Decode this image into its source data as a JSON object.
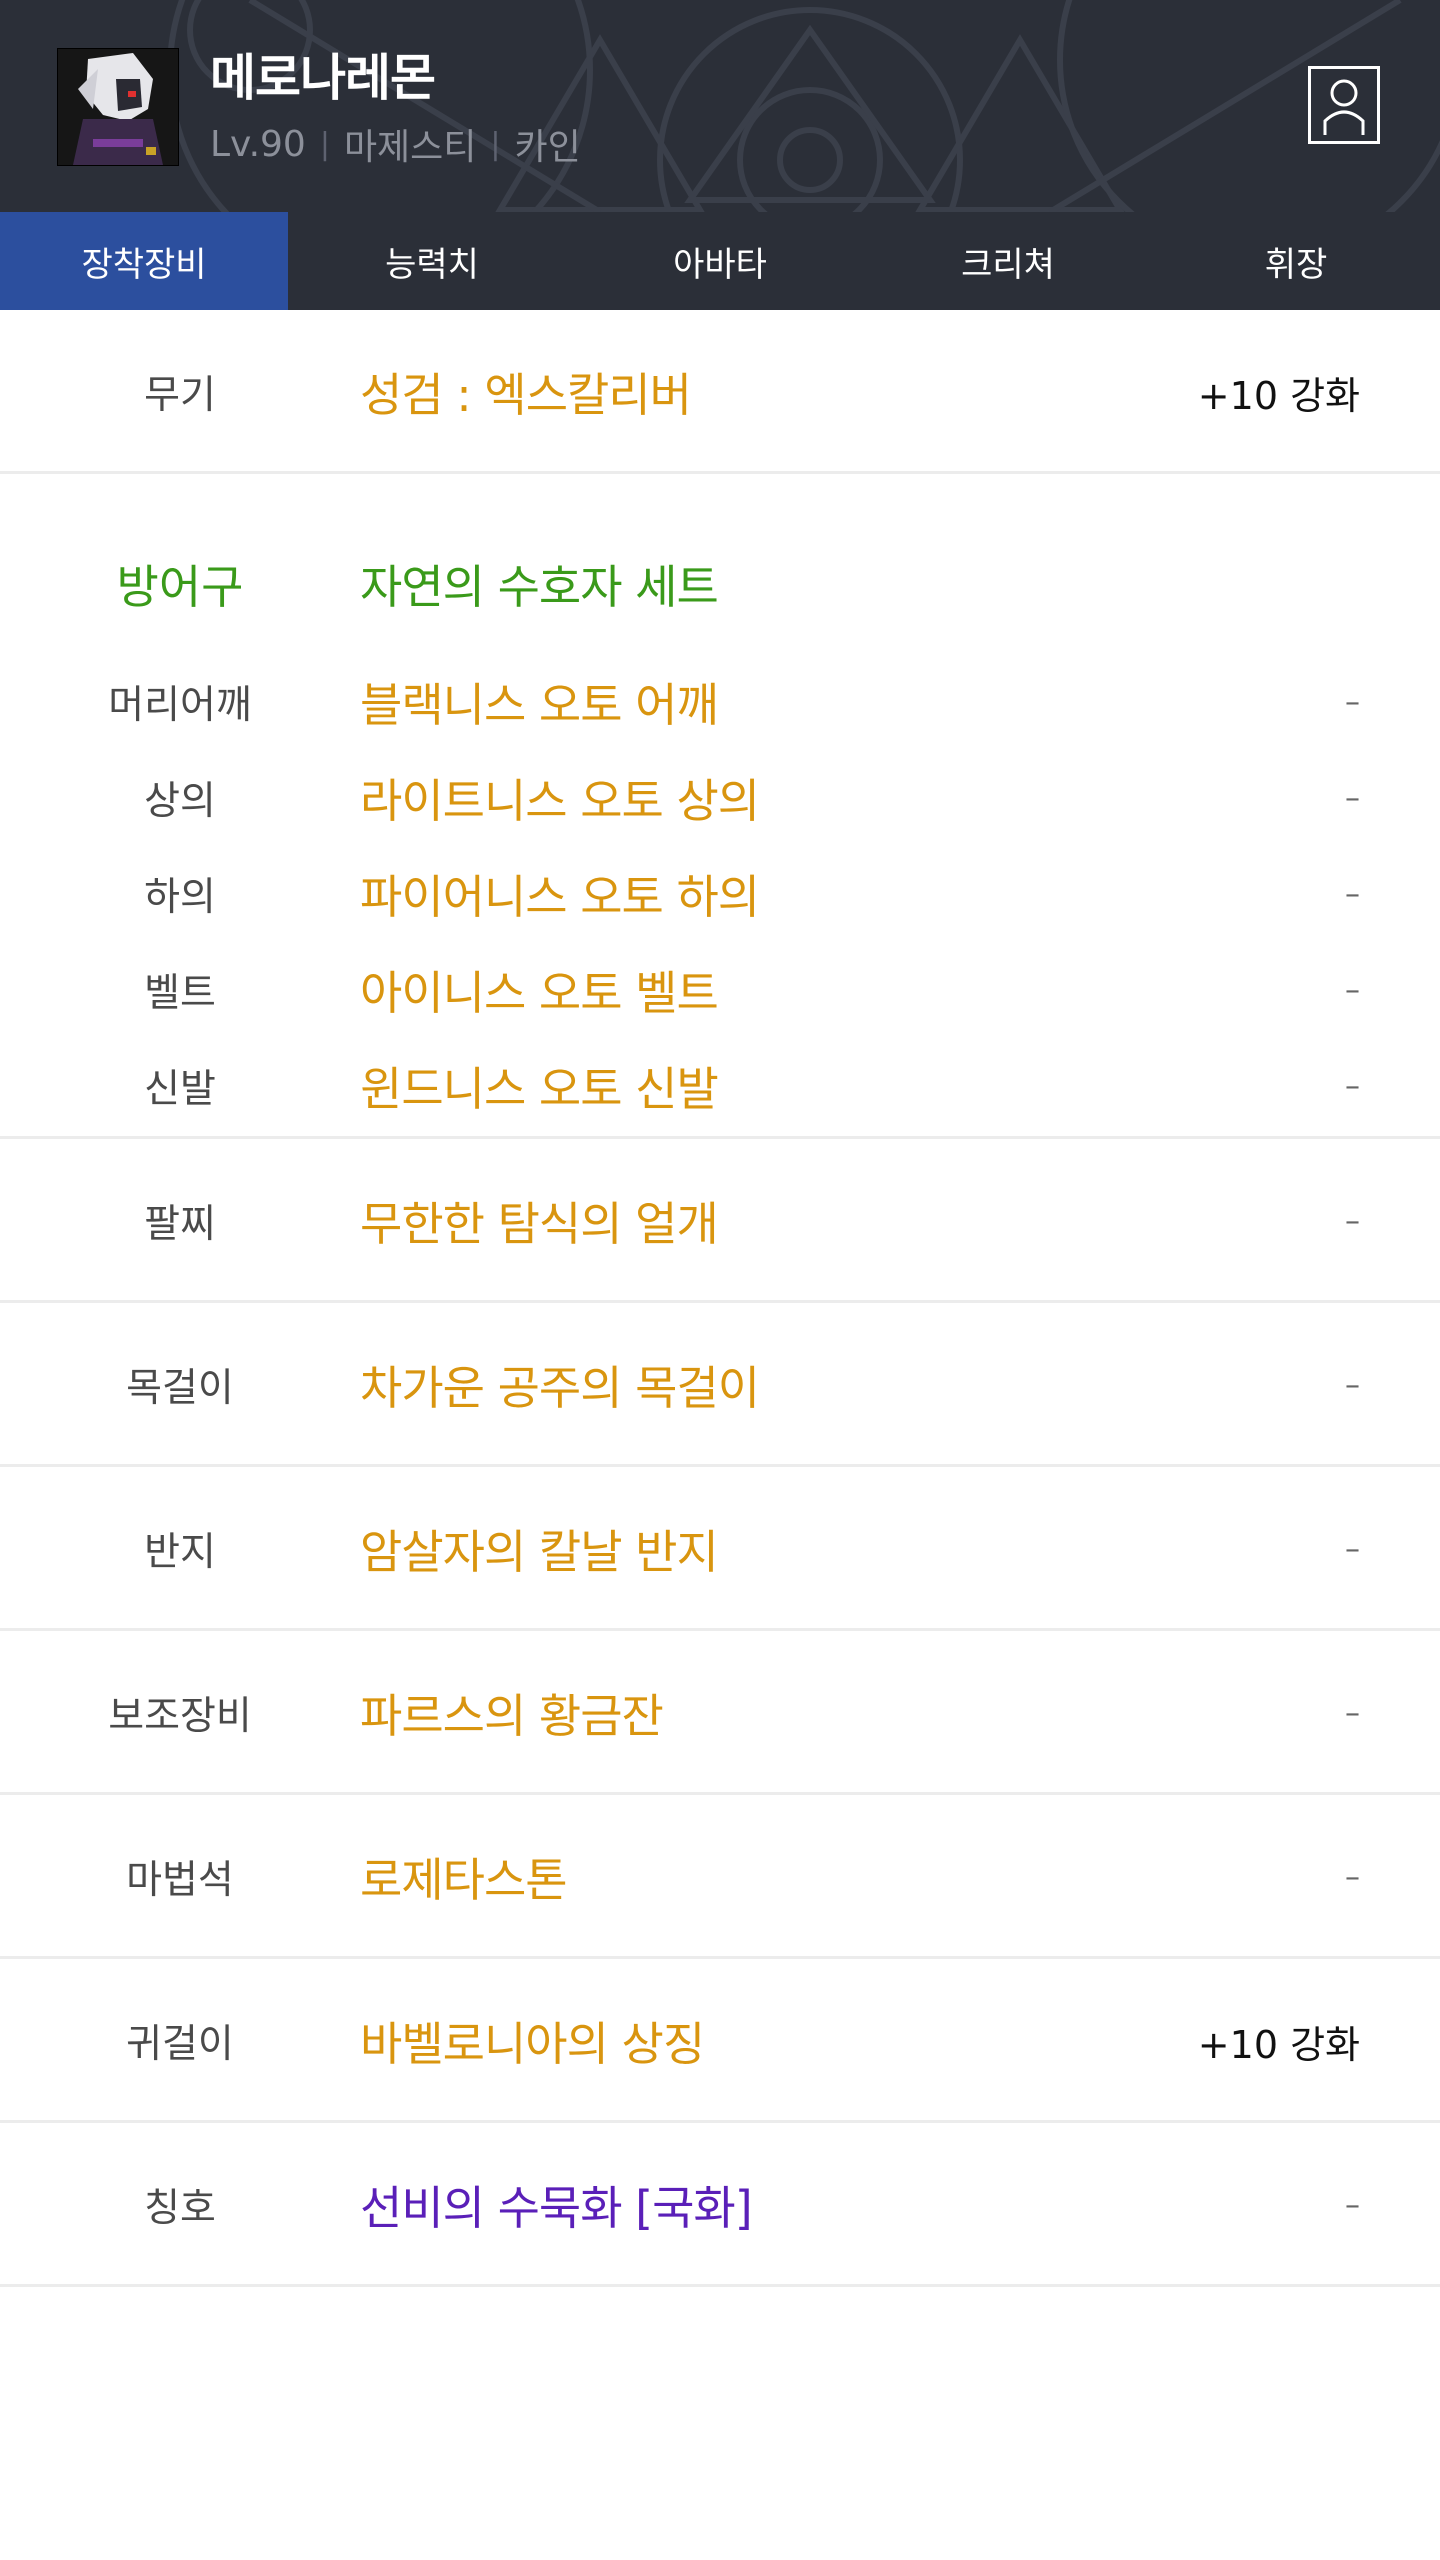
{
  "character": {
    "name": "메로나레몬",
    "level": "Lv.90",
    "class": "마제스티",
    "server": "카인",
    "separator": "|",
    "avatar_icon": "character-avatar-icon",
    "profile_icon": "profile-icon"
  },
  "tabs": [
    {
      "label": "장착장비",
      "active": true
    },
    {
      "label": "능력치",
      "active": false
    },
    {
      "label": "아바타",
      "active": false
    },
    {
      "label": "크리쳐",
      "active": false
    },
    {
      "label": "휘장",
      "active": false
    }
  ],
  "equipment": {
    "weapon": {
      "label": "무기",
      "item": "성검 : 엑스칼리버",
      "value": "+10 강화"
    },
    "armor": {
      "label": "방어구",
      "set_name": "자연의 수호자 세트",
      "pieces": [
        {
          "label": "머리어깨",
          "item": "블랙니스 오토 어깨",
          "value": "–"
        },
        {
          "label": "상의",
          "item": "라이트니스 오토 상의",
          "value": "–"
        },
        {
          "label": "하의",
          "item": "파이어니스 오토 하의",
          "value": "–"
        },
        {
          "label": "벨트",
          "item": "아이니스 오토 벨트",
          "value": "–"
        },
        {
          "label": "신발",
          "item": "윈드니스 오토 신발",
          "value": "–"
        }
      ]
    },
    "others": [
      {
        "label": "팔찌",
        "item": "무한한 탐식의 얼개",
        "value": "–"
      },
      {
        "label": "목걸이",
        "item": "차가운 공주의 목걸이",
        "value": "–"
      },
      {
        "label": "반지",
        "item": "암살자의 칼날 반지",
        "value": "–"
      },
      {
        "label": "보조장비",
        "item": "파르스의 황금잔",
        "value": "–"
      },
      {
        "label": "마법석",
        "item": "로제타스톤",
        "value": "–"
      },
      {
        "label": "귀걸이",
        "item": "바벨로니아의 상징",
        "value": "+10 강화"
      },
      {
        "label": "칭호",
        "item": "선비의 수묵화 [국화]",
        "value": "–"
      }
    ]
  },
  "colors": {
    "header_bg": "#2b2f38",
    "tab_active": "#2c4f9e",
    "item_unique": "#d9950f",
    "set_green": "#3a9a1a",
    "title_purple": "#5a1fb8"
  }
}
